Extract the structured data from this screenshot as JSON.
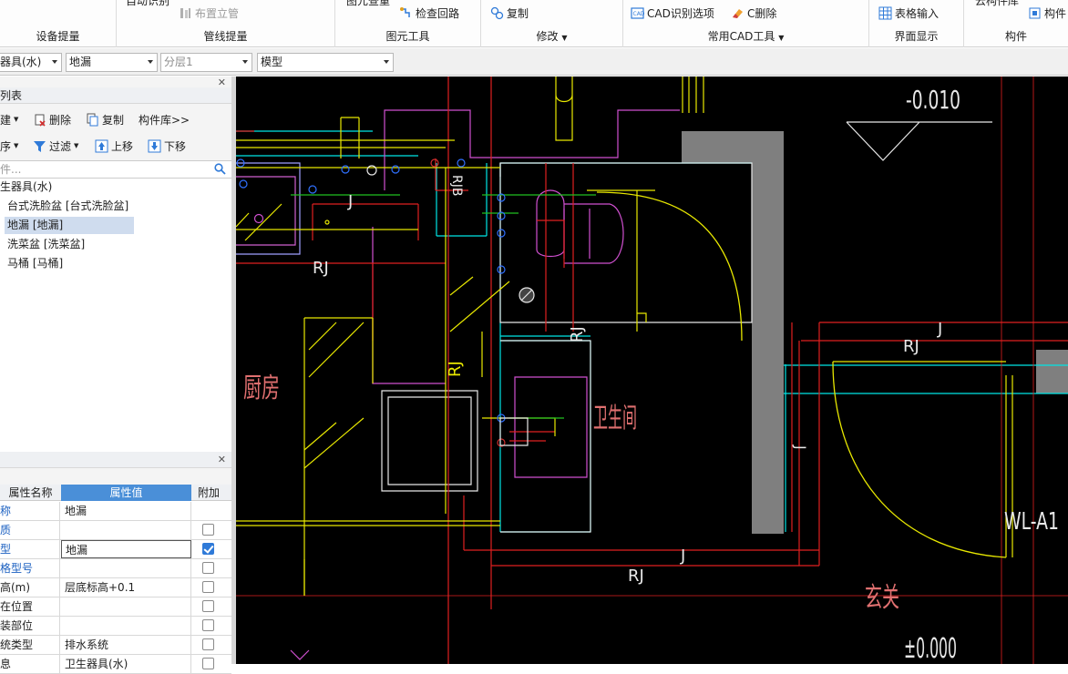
{
  "ribbon": {
    "groups": [
      {
        "title": "设备提量",
        "cut_label": "设备提量"
      },
      {
        "title": "管线提量",
        "cut_label": "自动识别",
        "buttons": [
          "布置立管"
        ]
      },
      {
        "title": "图元工具",
        "cut_label": "图元查重",
        "buttons": [
          "检查回路"
        ]
      },
      {
        "title": "修改",
        "buttons": [
          "复制"
        ]
      },
      {
        "title": "常用CAD工具",
        "buttons": [
          "CAD识别选项",
          "C删除"
        ]
      },
      {
        "title": "界面显示",
        "buttons": [
          "表格输入"
        ]
      },
      {
        "title": "构件",
        "cut_label": "云构件库",
        "buttons": [
          "构件"
        ]
      }
    ]
  },
  "selectors": {
    "type": "器具(水)",
    "component": "地漏",
    "layer": "分层1",
    "mode": "模型"
  },
  "component_list": {
    "title": "列表",
    "toolbar1": [
      "建",
      "删除",
      "复制",
      "构件库>>"
    ],
    "toolbar2": [
      "序",
      "过滤",
      "上移",
      "下移"
    ],
    "search_placeholder": "件...",
    "tree": [
      {
        "label": "生器具(水)",
        "level": 0
      },
      {
        "label": "台式洗脸盆 [台式洗脸盆]",
        "level": 1
      },
      {
        "label": "地漏 [地漏]",
        "level": 1,
        "selected": true
      },
      {
        "label": "洗菜盆 [洗菜盆]",
        "level": 1
      },
      {
        "label": "马桶 [马桶]",
        "level": 1
      }
    ]
  },
  "properties": {
    "headers": [
      "属性名称",
      "属性值",
      "附加"
    ],
    "rows": [
      {
        "name": "称",
        "value": "地漏",
        "blue": true,
        "checkbox": false
      },
      {
        "name": "质",
        "value": "",
        "blue": true,
        "checkbox": true,
        "checked": false
      },
      {
        "name": "型",
        "value": "地漏",
        "blue": true,
        "checkbox": true,
        "checked": true,
        "editing": true
      },
      {
        "name": "格型号",
        "value": "",
        "blue": true,
        "checkbox": true,
        "checked": false
      },
      {
        "name": "高(m)",
        "value": "层底标高+0.1",
        "blue": false,
        "checkbox": true,
        "checked": false
      },
      {
        "name": "在位置",
        "value": "",
        "blue": false,
        "checkbox": true,
        "checked": false
      },
      {
        "name": "装部位",
        "value": "",
        "blue": false,
        "checkbox": true,
        "checked": false
      },
      {
        "name": "统类型",
        "value": "排水系统",
        "blue": false,
        "checkbox": true,
        "checked": false
      },
      {
        "name": "息",
        "value": "卫生器具(水)",
        "blue": false,
        "checkbox": true,
        "checked": false
      }
    ]
  },
  "cad": {
    "labels": {
      "elev_top": "-0.010",
      "elev_bottom": "±0.000",
      "kitchen": "厨房",
      "bathroom": "卫生间",
      "entrance": "玄关",
      "wl": "WL-A1",
      "rj": "RJ",
      "j": "J",
      "rjb": "RJB"
    }
  },
  "colors": {
    "accent": "#2f7ad8",
    "selected_row": "#cfdcee",
    "canvas_bg": "#000000"
  }
}
